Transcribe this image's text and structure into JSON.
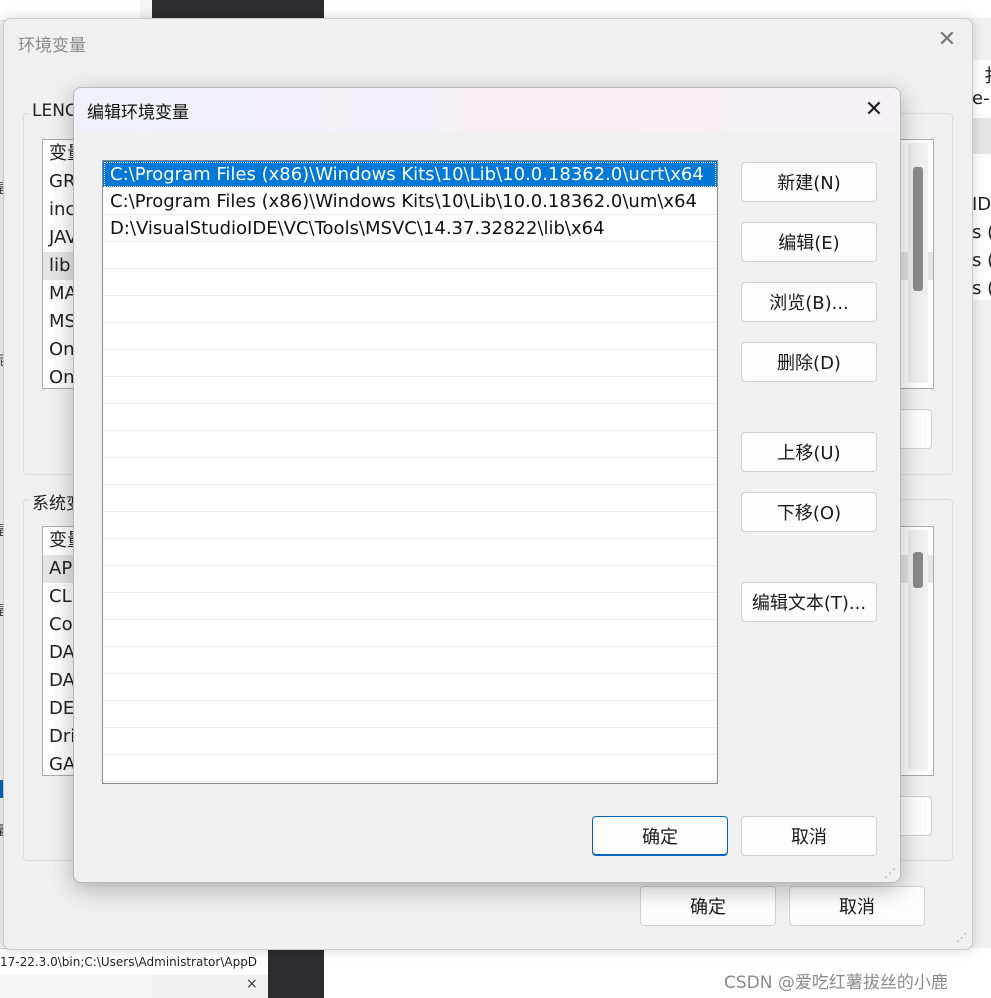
{
  "background": {
    "bottom_path_text": "17-22.3.0\\bin;C:\\Users\\Administrator\\AppD",
    "right_edge_fragments": [
      "扌",
      "e-i",
      "ID",
      "s (",
      "s (",
      "s ("
    ],
    "left_edge_fragments": [
      "是",
      "泥",
      "是",
      "是",
      "量"
    ],
    "close_x": "×"
  },
  "outer_dialog": {
    "title": "环境变量",
    "user_group_label": "LENC",
    "user_vars_fragments": [
      "变量",
      "GR",
      "inc",
      "JAV",
      "lib",
      "MA",
      "MS",
      "On",
      "On"
    ],
    "system_group_label": "系统变",
    "system_vars_fragments": [
      "变量",
      "AP",
      "CLI",
      "Co",
      "DA",
      "DA",
      "DE",
      "Dri",
      "GA"
    ],
    "ok_label": "确定",
    "cancel_label": "取消"
  },
  "edit_dialog": {
    "title": "编辑环境变量",
    "paths": [
      "C:\\Program Files (x86)\\Windows Kits\\10\\Lib\\10.0.18362.0\\ucrt\\x64",
      "C:\\Program Files (x86)\\Windows Kits\\10\\Lib\\10.0.18362.0\\um\\x64",
      "D:\\VisualStudioIDE\\VC\\Tools\\MSVC\\14.37.32822\\lib\\x64"
    ],
    "selected_index": 0,
    "buttons": {
      "new": "新建(N)",
      "edit": "编辑(E)",
      "browse": "浏览(B)...",
      "delete": "删除(D)",
      "move_up": "上移(U)",
      "move_down": "下移(O)",
      "edit_text": "编辑文本(T)...",
      "ok": "确定",
      "cancel": "取消"
    }
  },
  "watermark": "CSDN @爱吃红薯拔丝的小鹿"
}
